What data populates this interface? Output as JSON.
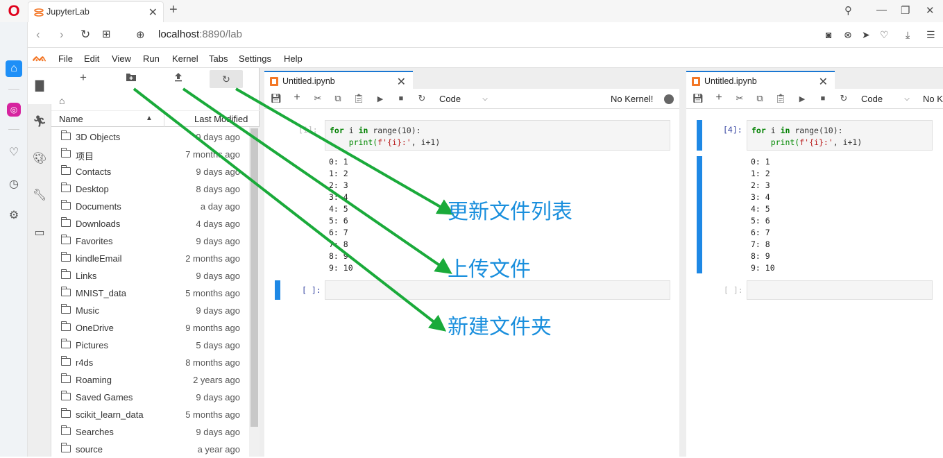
{
  "browser": {
    "tab_title": "JupyterLab",
    "url_host": "localhost",
    "url_rest": ":8890/lab",
    "new_tab": "+"
  },
  "menu": [
    "File",
    "Edit",
    "View",
    "Run",
    "Kernel",
    "Tabs",
    "Settings",
    "Help"
  ],
  "filebrowser": {
    "col_name": "Name",
    "col_modified": "Last Modified",
    "files": [
      {
        "name": "3D Objects",
        "modified": "9 days ago"
      },
      {
        "name": "项目",
        "modified": "7 months ago"
      },
      {
        "name": "Contacts",
        "modified": "9 days ago"
      },
      {
        "name": "Desktop",
        "modified": "8 days ago"
      },
      {
        "name": "Documents",
        "modified": "a day ago"
      },
      {
        "name": "Downloads",
        "modified": "4 days ago"
      },
      {
        "name": "Favorites",
        "modified": "9 days ago"
      },
      {
        "name": "kindleEmail",
        "modified": "2 months ago"
      },
      {
        "name": "Links",
        "modified": "9 days ago"
      },
      {
        "name": "MNIST_data",
        "modified": "5 months ago"
      },
      {
        "name": "Music",
        "modified": "9 days ago"
      },
      {
        "name": "OneDrive",
        "modified": "9 months ago"
      },
      {
        "name": "Pictures",
        "modified": "5 days ago"
      },
      {
        "name": "r4ds",
        "modified": "8 months ago"
      },
      {
        "name": "Roaming",
        "modified": "2 years ago"
      },
      {
        "name": "Saved Games",
        "modified": "9 days ago"
      },
      {
        "name": "scikit_learn_data",
        "modified": "5 months ago"
      },
      {
        "name": "Searches",
        "modified": "9 days ago"
      },
      {
        "name": "source",
        "modified": "a year ago"
      }
    ]
  },
  "notebook_left": {
    "tab_title": "Untitled.ipynb",
    "cell_type": "Code",
    "kernel": "No Kernel!",
    "prompt_in": "[1]:",
    "prompt_empty": "[ ]:"
  },
  "notebook_right": {
    "tab_title": "Untitled.ipynb",
    "cell_type": "Code",
    "kernel": "No K",
    "prompt_in": "[4]:",
    "prompt_empty": "[ ]:"
  },
  "code": {
    "line1_kw1": "for",
    "line1_mid": " i ",
    "line1_kw2": "in",
    "line1_end": " range(10):",
    "line2_pre": "    print(",
    "line2_str": "f'{i}:'",
    "line2_end": ", i+1)"
  },
  "outputs": [
    "0: 1",
    "1: 2",
    "2: 3",
    "3: 4",
    "4: 5",
    "5: 6",
    "6: 7",
    "7: 8",
    "8: 9",
    "9: 10"
  ],
  "annotations": {
    "refresh": "更新文件列表",
    "upload": "上传文件",
    "new_folder": "新建文件夹"
  },
  "colors": {
    "accent": "#1976d2",
    "arrow": "#1aaa3a",
    "annotation_text": "#1a8fdd",
    "jupyter_orange": "#f37626"
  }
}
